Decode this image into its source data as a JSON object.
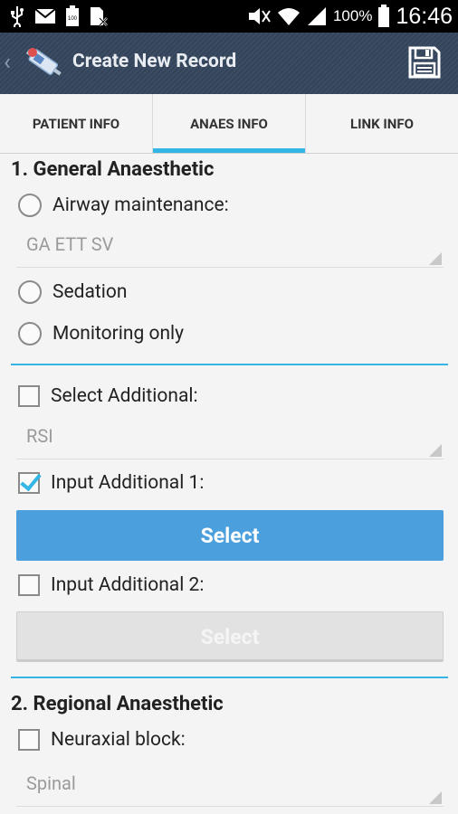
{
  "status_bar": {
    "battery_percent": "100%",
    "time": "16:46",
    "icons": [
      "usb-icon",
      "gmail-icon",
      "battery-notification-icon",
      "sim-icon",
      "mute-icon",
      "wifi-icon",
      "signal-icon",
      "battery-icon"
    ]
  },
  "action_bar": {
    "title": "Create New Record"
  },
  "tabs": [
    {
      "label": "PATIENT INFO",
      "active": false
    },
    {
      "label": "ANAES INFO",
      "active": true
    },
    {
      "label": "LINK INFO",
      "active": false
    }
  ],
  "general": {
    "title": "1. General Anaesthetic",
    "airway_label": "Airway maintenance:",
    "airway_value": "GA ETT SV",
    "sedation_label": "Sedation",
    "monitoring_label": "Monitoring only",
    "select_additional_label": "Select Additional:",
    "select_additional_value": "RSI",
    "input1_label": "Input Additional 1:",
    "input1_checked": true,
    "input1_button": "Select",
    "input2_label": "Input Additional 2:",
    "input2_checked": false,
    "input2_button": "Select"
  },
  "regional": {
    "title": "2. Regional Anaesthetic",
    "neuraxial_label": "Neuraxial block:",
    "neuraxial_value": "Spinal"
  },
  "colors": {
    "accent": "#33b5e5",
    "button_blue": "#4a9fdc",
    "action_bar": "#3c4d63"
  }
}
